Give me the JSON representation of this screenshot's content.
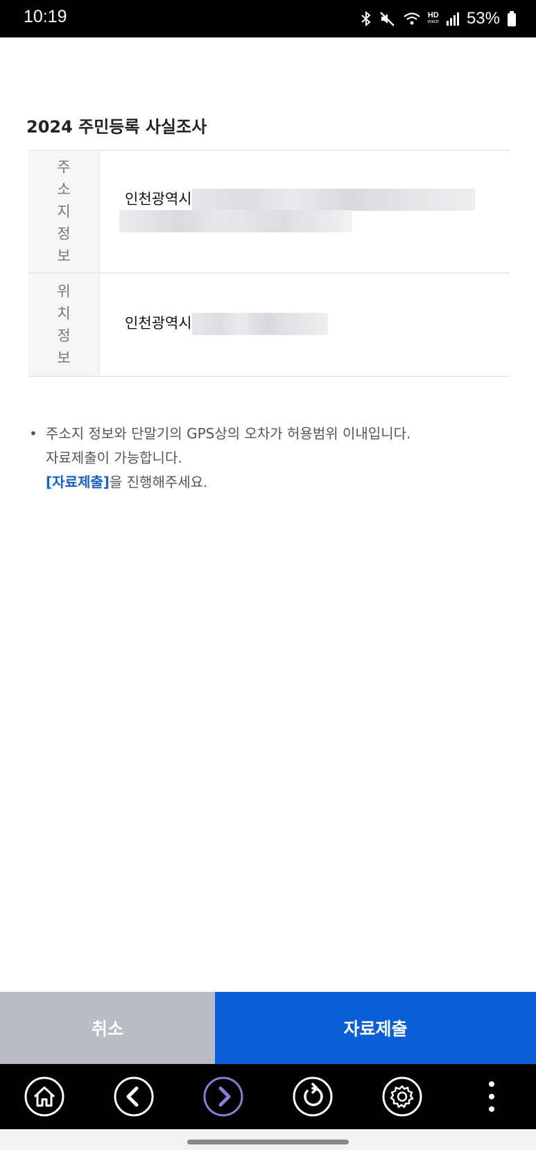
{
  "status_bar": {
    "time": "10:19",
    "hd_label": "HD",
    "hd_sub": "voice",
    "battery_percent": "53%",
    "icons": [
      "bluetooth-icon",
      "mute-icon",
      "wifi-icon",
      "hd-voice-icon",
      "signal-icon",
      "battery-icon"
    ]
  },
  "page": {
    "title": "2024 주민등록 사실조사"
  },
  "info_table": {
    "rows": [
      {
        "label": "주소지정보",
        "value": "인천광역시"
      },
      {
        "label": "위치정보",
        "value": "인천광역시"
      }
    ]
  },
  "notice": {
    "bullet": "•",
    "line1": "주소지 정보와 단말기의 GPS상의 오차가 허용범위 이내입니다.",
    "line2": "자료제출이 가능합니다.",
    "link_text": "[자료제출]",
    "line3_rest": "을 진행해주세요."
  },
  "buttons": {
    "cancel": "취소",
    "submit": "자료제출"
  },
  "bottom_nav": {
    "items": [
      "home-icon",
      "back-icon",
      "forward-icon",
      "refresh-icon",
      "settings-icon",
      "more-icon"
    ]
  },
  "colors": {
    "primary": "#0a5ed8",
    "cancel_bg": "#b8bcc4",
    "link": "#1a5fcf",
    "forward_accent": "#8a7fd8"
  }
}
